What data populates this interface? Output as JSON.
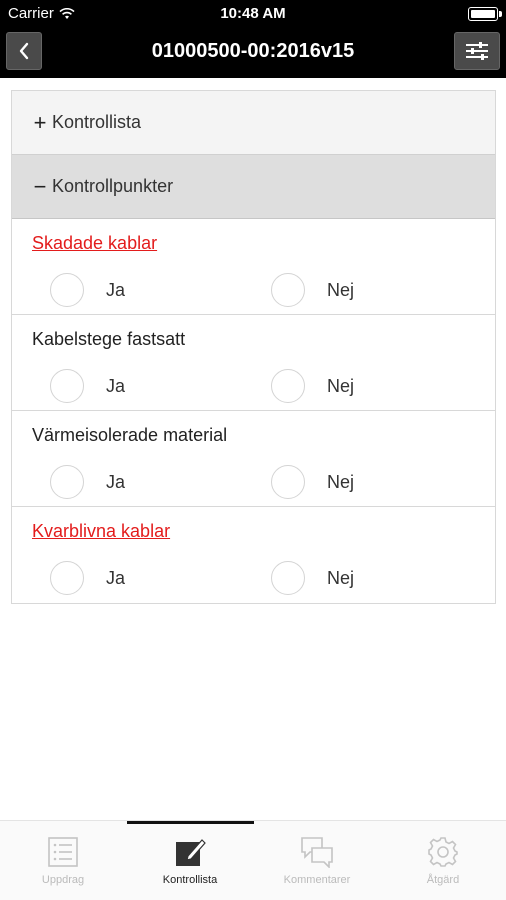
{
  "status_bar": {
    "carrier": "Carrier",
    "time": "10:48 AM"
  },
  "nav": {
    "title": "01000500-00:2016v15",
    "back_icon": "chevron-left-icon",
    "filter_icon": "sliders-icon"
  },
  "sections": {
    "list": {
      "sign": "+",
      "label": "Kontrollista"
    },
    "points": {
      "sign": "−",
      "label": "Kontrollpunkter"
    }
  },
  "questions": [
    {
      "label": "Skadade kablar",
      "alert": true,
      "options": [
        "Ja",
        "Nej"
      ]
    },
    {
      "label": "Kabelstege fastsatt",
      "alert": false,
      "options": [
        "Ja",
        "Nej"
      ]
    },
    {
      "label": "Värmeisolerade material",
      "alert": false,
      "options": [
        "Ja",
        "Nej"
      ]
    },
    {
      "label": "Kvarblivna kablar",
      "alert": true,
      "options": [
        "Ja",
        "Nej"
      ]
    }
  ],
  "colors": {
    "alert": "#e31c1c",
    "nav_bg": "#000000",
    "active_tab": "#222222",
    "inactive_tab": "#bbbbbb"
  },
  "tabs": [
    {
      "label": "Uppdrag",
      "icon": "list-icon",
      "active": false
    },
    {
      "label": "Kontrollista",
      "icon": "edit-icon",
      "active": true
    },
    {
      "label": "Kommentarer",
      "icon": "chat-bubbles-icon",
      "active": false
    },
    {
      "label": "Åtgärd",
      "icon": "gear-icon",
      "active": false
    }
  ]
}
